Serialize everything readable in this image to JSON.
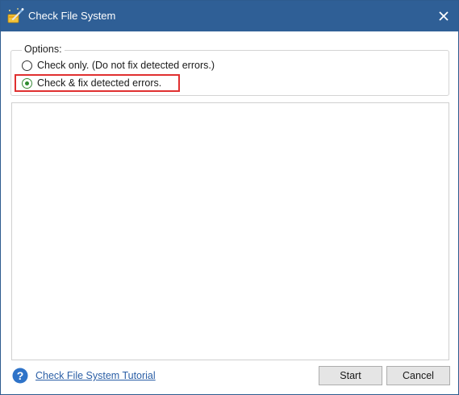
{
  "window": {
    "title": "Check File System"
  },
  "options": {
    "legend": "Options:",
    "items": [
      {
        "label": "Check only. (Do not fix detected errors.)",
        "checked": false
      },
      {
        "label": "Check & fix detected errors.",
        "checked": true
      }
    ]
  },
  "footer": {
    "tutorial_link": "Check File System Tutorial",
    "start_label": "Start",
    "cancel_label": "Cancel"
  },
  "colors": {
    "titlebar": "#2f5f96",
    "highlight": "#e03030",
    "link": "#2b5fa6",
    "radio_selected": "#2f8a2f"
  },
  "icons": [
    "app-wand-icon",
    "close-icon",
    "help-icon"
  ]
}
